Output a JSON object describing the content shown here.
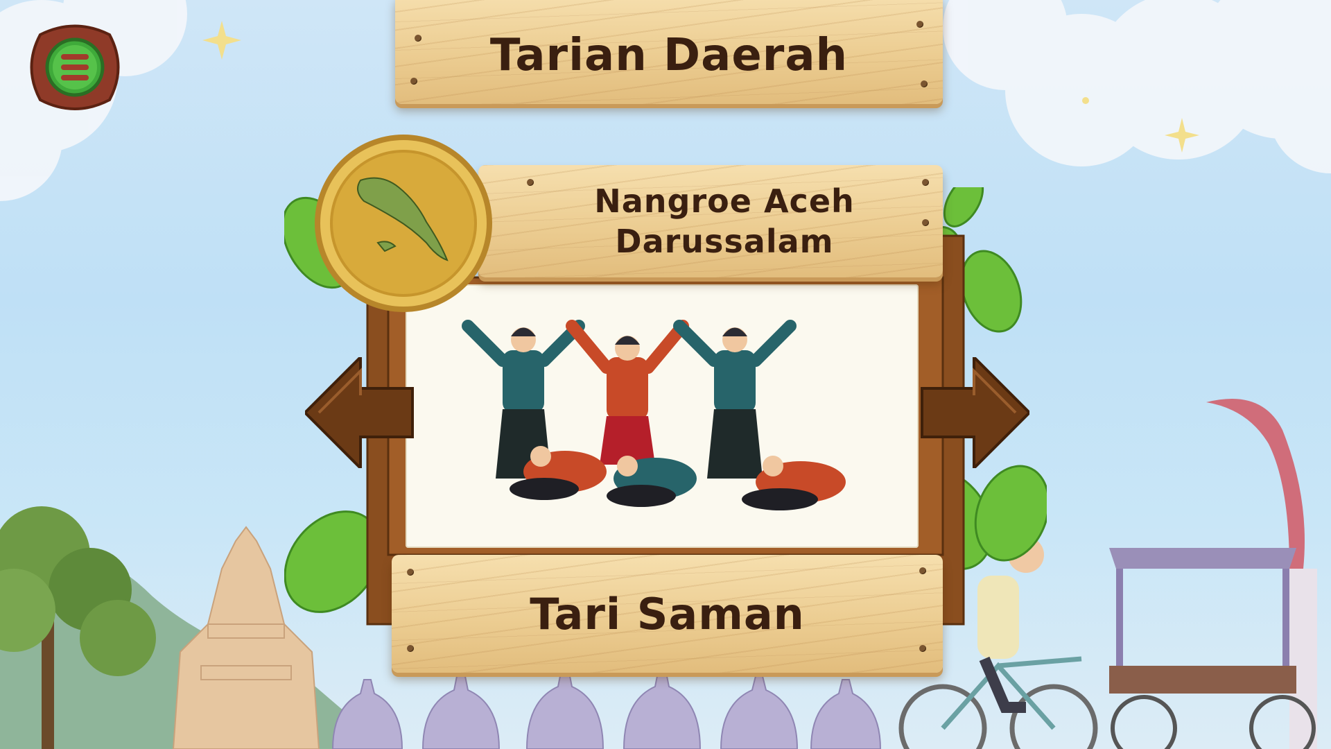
{
  "header": {
    "title": "Tarian Daerah"
  },
  "region": {
    "name_line1": "Nangroe Aceh",
    "name_line2": "Darussalam"
  },
  "dance": {
    "name": "Tari Saman"
  },
  "icons": {
    "menu": "menu-icon",
    "region_coin": "aceh-map-coin-icon",
    "prev": "arrow-left-icon",
    "next": "arrow-right-icon"
  },
  "colors": {
    "plank": "#eccd92",
    "text": "#3a1f10",
    "frame": "#8a4e1f",
    "arrow": "#6b3a15",
    "coin": "#d8aa3b",
    "leaf": "#6cbf3a",
    "sky": "#c6e3f7"
  }
}
